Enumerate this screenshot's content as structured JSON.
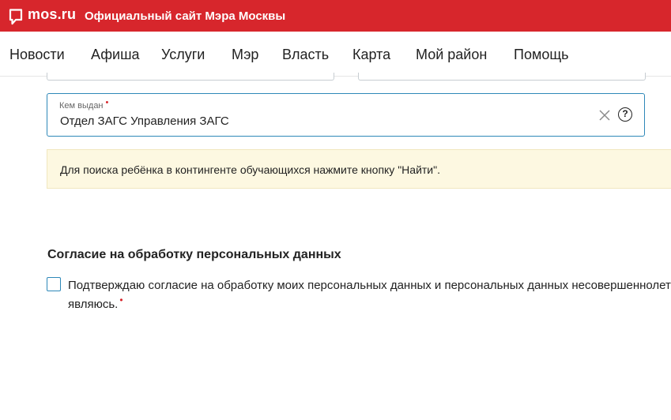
{
  "header": {
    "logo_text": "mos.ru",
    "site_title": "Официальный сайт Мэра Москвы"
  },
  "nav": {
    "items": [
      {
        "label": "Новости"
      },
      {
        "label": "Афиша"
      },
      {
        "label": "Услуги"
      },
      {
        "label": "Мэр"
      },
      {
        "label": "Власть"
      },
      {
        "label": "Карта"
      },
      {
        "label": "Мой район"
      },
      {
        "label": "Помощь"
      }
    ]
  },
  "form": {
    "issued_by": {
      "label": "Кем выдан",
      "required_mark": "•",
      "value": "Отдел ЗАГС Управления ЗАГС",
      "help_glyph": "?"
    },
    "info_message": "Для поиска ребёнка в контингенте обучающихся нажмите кнопку \"Найти\"."
  },
  "consent": {
    "section_title": "Согласие на обработку персональных данных",
    "line1": "Подтверждаю согласие на обработку моих персональных данных и персональных данных несовершеннолет",
    "line2": "являюсь.",
    "required_mark": "•",
    "checked": false
  },
  "colors": {
    "brand_red": "#d7262c",
    "field_border_active": "#2e88b8",
    "info_bg": "#fdf8e1"
  },
  "icons": {
    "logo": "speech-bubble-icon",
    "clear": "close-icon",
    "help": "question-circle-icon"
  }
}
